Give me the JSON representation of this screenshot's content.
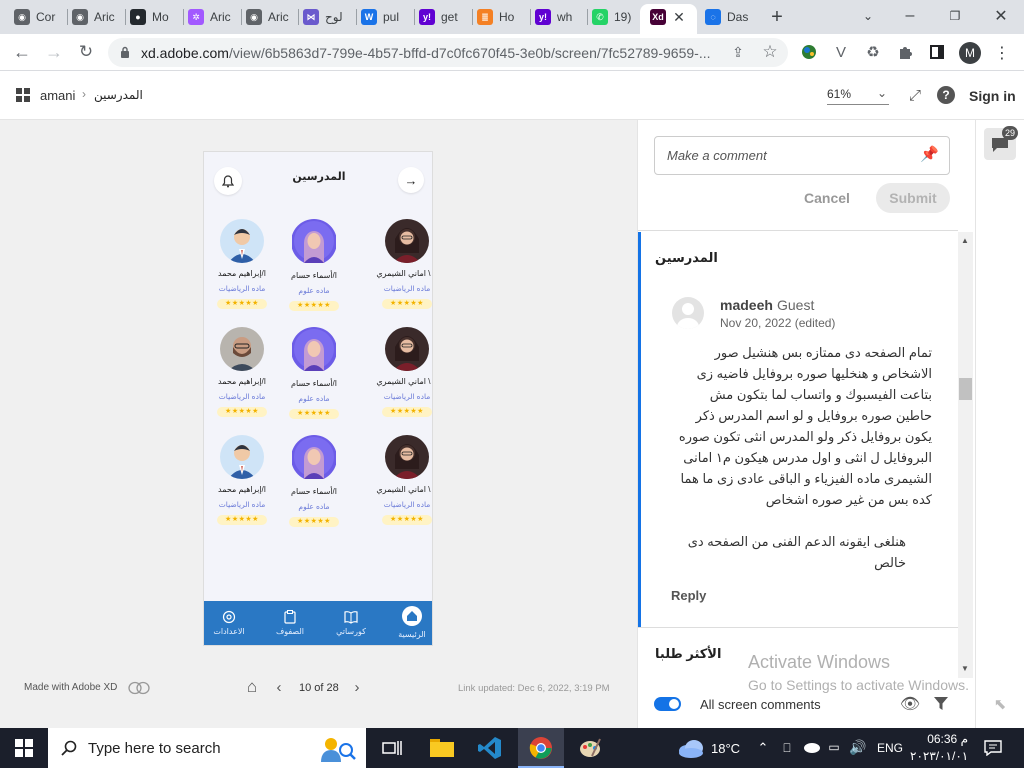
{
  "browser": {
    "tabs": [
      {
        "label": "Cor",
        "icon": "chrome-icon",
        "color": "#5f6368"
      },
      {
        "label": "Aric",
        "icon": "chrome-icon",
        "color": "#5f6368"
      },
      {
        "label": "Mo",
        "icon": "github-icon",
        "color": "#24292e"
      },
      {
        "label": "Aric",
        "icon": "figma-icon",
        "color": "#a259ff"
      },
      {
        "label": "Aric",
        "icon": "chrome-icon",
        "color": "#5f6368"
      },
      {
        "label": "لوح",
        "icon": "pattern-icon",
        "color": "#6a5acd"
      },
      {
        "label": "pul",
        "icon": "wordpress-icon",
        "color": "#1a73e8"
      },
      {
        "label": "get",
        "icon": "yahoo-icon",
        "color": "#6001d2"
      },
      {
        "label": "Ho",
        "icon": "stack-icon",
        "color": "#f48024"
      },
      {
        "label": "wh",
        "icon": "yahoo-icon",
        "color": "#6001d2"
      },
      {
        "label": "19)",
        "icon": "whatsapp-icon",
        "color": "#25d366"
      },
      {
        "label": "",
        "icon": "xd-icon",
        "color": "#470137"
      },
      {
        "label": "Das",
        "icon": "loading-icon",
        "color": "#1a73e8"
      }
    ],
    "url_host": "xd.adobe.com",
    "url_path": "/view/6b5863d7-799e-4b57-bffd-d7c0fc670f45-3e0b/screen/7fc52789-9659-...",
    "profile_initial": "M"
  },
  "xd": {
    "breadcrumb_user": "amani",
    "breadcrumb_page": "المدرسين",
    "zoom": "61%",
    "sign_in": "Sign in",
    "made_with": "Made with Adobe XD",
    "pager": "10 of 28",
    "link_updated": "Link updated: Dec 6, 2022, 3:19 PM"
  },
  "phone": {
    "title": "المدرسين",
    "stars": "★★★★★",
    "teachers": [
      {
        "name": "م \\ اماني الشيمري",
        "subject": "ماده الرياضيات",
        "avatar": "woman"
      },
      {
        "name": "ا/أسماء حسام",
        "subject": "ماده علوم",
        "avatar": "hijab"
      },
      {
        "name": "ا/إبراهيم محمد",
        "subject": "ماده الرياضيات",
        "avatar": "man"
      },
      {
        "name": "م \\ اماني الشيمري",
        "subject": "ماده الرياضيات",
        "avatar": "woman"
      },
      {
        "name": "ا/أسماء حسام",
        "subject": "ماده علوم",
        "avatar": "hijab"
      },
      {
        "name": "ا/إبراهيم محمد",
        "subject": "ماده الرياضيات",
        "avatar": "photo"
      },
      {
        "name": "م \\ اماني الشيمري",
        "subject": "ماده الرياضيات",
        "avatar": "woman"
      },
      {
        "name": "ا/أسماء حسام",
        "subject": "ماده علوم",
        "avatar": "hijab"
      },
      {
        "name": "ا/إبراهيم محمد",
        "subject": "ماده الرياضيات",
        "avatar": "man"
      }
    ],
    "nav": [
      {
        "label": "الرئيسية",
        "icon": "home-icon"
      },
      {
        "label": "كورساتي",
        "icon": "book-icon"
      },
      {
        "label": "الصفوف",
        "icon": "clipboard-icon"
      },
      {
        "label": "الاعدادات",
        "icon": "settings-icon"
      }
    ]
  },
  "comments": {
    "placeholder": "Make a comment",
    "cancel": "Cancel",
    "submit": "Submit",
    "screen_title": "المدرسين",
    "author": "madeeh",
    "author_role": "Guest",
    "date": "Nov 20, 2022 (edited)",
    "body_lines": [
      "تمام الصفحه دى ممتازه بس هنشيل صور",
      "الاشخاص و هنخليها صوره بروفايل فاضيه زى",
      "بتاعت الفيسبوك و واتساب لما بتكون مش",
      "حاطين صوره بروفايل و لو اسم المدرس ذكر",
      "يكون بروفايل ذكر ولو المدرس انثى تكون صوره",
      "البروفايل ل انثى و اول مدرس هيكون م١ امانى",
      "الشيمرى ماده الفيزياء و الباقى عادى زى ما هما",
      "كده بس من غير صوره اشخاص"
    ],
    "body2_lines": [
      "هنلغى ايقونه الدعم الفنى من الصفحه دى",
      "خالص"
    ],
    "reply": "Reply",
    "next_screen": "الأكثر طلبا",
    "toggle_label": "All screen comments",
    "badge_count": "29"
  },
  "watermark": {
    "line1": "Activate Windows",
    "line2": "Go to Settings to activate Windows."
  },
  "taskbar": {
    "search_placeholder": "Type here to search",
    "weather": "18°C",
    "lang": "ENG",
    "time": "06:36 م",
    "date": "٢٠٢٣/٠١/٠١"
  }
}
